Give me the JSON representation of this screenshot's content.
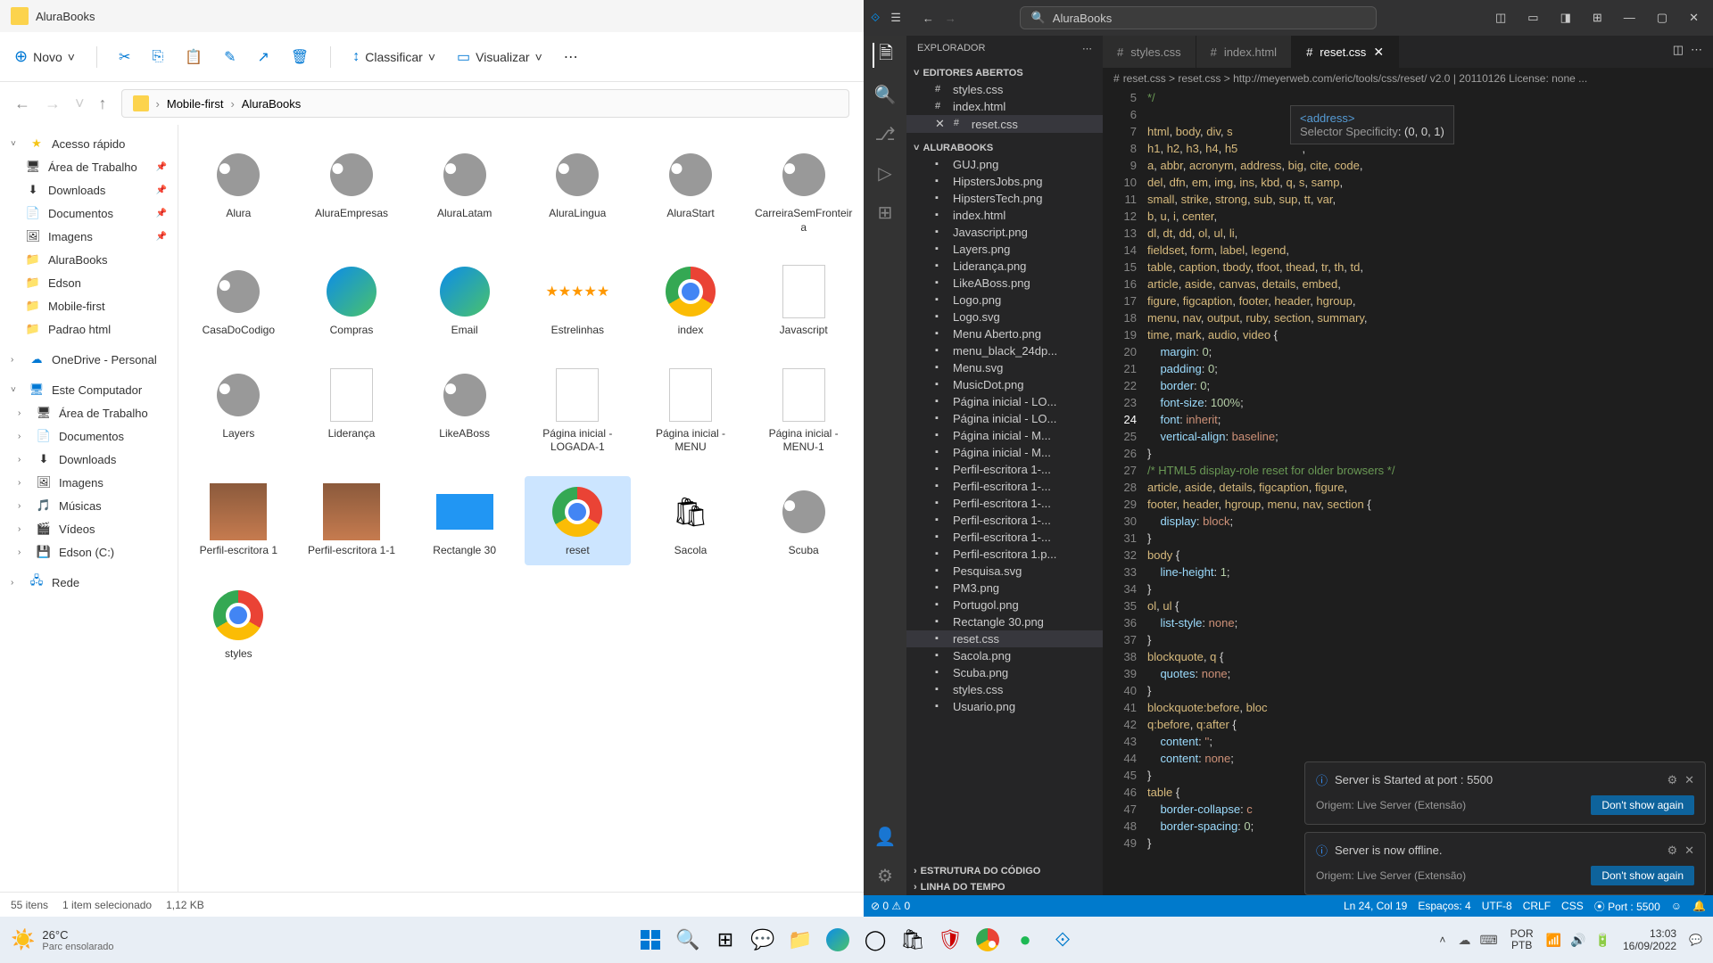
{
  "explorer": {
    "title": "AluraBooks",
    "toolbar": {
      "novo": "Novo",
      "classificar": "Classificar",
      "visualizar": "Visualizar"
    },
    "breadcrumb": [
      "Mobile-first",
      "AluraBooks"
    ],
    "sidebar": {
      "quick_access": "Acesso rápido",
      "items_pinned": [
        "Área de Trabalho",
        "Downloads",
        "Documentos",
        "Imagens",
        "AluraBooks",
        "Edson",
        "Mobile-first",
        "Padrao html"
      ],
      "onedrive": "OneDrive - Personal",
      "this_pc": "Este Computador",
      "pc_items": [
        "Área de Trabalho",
        "Documentos",
        "Downloads",
        "Imagens",
        "Músicas",
        "Vídeos",
        "Edson  (C:)"
      ],
      "network": "Rede"
    },
    "files": [
      "Alura",
      "AluraEmpresas",
      "AluraLatam",
      "AluraLingua",
      "AluraStart",
      "CarreiraSemFronteira",
      "CasaDoCodigo",
      "Compras",
      "Email",
      "Estrelinhas",
      "index",
      "Javascript",
      "Layers",
      "Liderança",
      "LikeABoss",
      "Página inicial - LOGADA-1",
      "Página inicial - MENU",
      "Página inicial - MENU-1",
      "Perfil-escritora 1",
      "Perfil-escritora 1-1",
      "Rectangle 30",
      "reset",
      "Sacola",
      "Scuba",
      "styles"
    ],
    "status": {
      "count": "55 itens",
      "selected": "1 item selecionado",
      "size": "1,12 KB"
    }
  },
  "vscode": {
    "search_title": "AluraBooks",
    "sidebar": {
      "title": "EXPLORADOR",
      "open_editors": "EDITORES ABERTOS",
      "open_files": [
        "styles.css",
        "index.html",
        "reset.css"
      ],
      "project": "ALURABOOKS",
      "files": [
        "GUJ.png",
        "HipstersJobs.png",
        "HipstersTech.png",
        "index.html",
        "Javascript.png",
        "Layers.png",
        "Liderança.png",
        "LikeABoss.png",
        "Logo.png",
        "Logo.svg",
        "Menu Aberto.png",
        "menu_black_24dp...",
        "Menu.svg",
        "MusicDot.png",
        "Página inicial - LO...",
        "Página inicial - LO...",
        "Página inicial - M...",
        "Página inicial - M...",
        "Perfil-escritora 1-...",
        "Perfil-escritora 1-...",
        "Perfil-escritora 1-...",
        "Perfil-escritora 1-...",
        "Perfil-escritora 1-...",
        "Perfil-escritora 1.p...",
        "Pesquisa.svg",
        "PM3.png",
        "Portugol.png",
        "Rectangle 30.png",
        "reset.css",
        "Sacola.png",
        "Scuba.png",
        "styles.css",
        "Usuario.png"
      ],
      "outline": "ESTRUTURA DO CÓDIGO",
      "timeline": "LINHA DO TEMPO"
    },
    "tabs": [
      "styles.css",
      "index.html",
      "reset.css"
    ],
    "active_tab": "reset.css",
    "breadcrumb": "reset.css > reset.css > http://meyerweb.com/eric/tools/css/reset/   v2.0 | 20110126   License: none ...",
    "tooltip": {
      "tag": "<address>",
      "spec_label": "Selector Specificity",
      "spec_value": ": (0, 0, 1)"
    },
    "notifications": [
      {
        "msg": "Server is Started at port : 5500",
        "origin": "Origem: Live Server (Extensão)",
        "btn": "Don't show again"
      },
      {
        "msg": "Server is now offline.",
        "origin": "Origem: Live Server (Extensão)",
        "btn": "Don't show again"
      }
    ],
    "status": {
      "errors": "⊘ 0 ⚠ 0",
      "line": "Ln 24, Col 19",
      "spaces": "Espaços: 4",
      "encoding": "UTF-8",
      "eol": "CRLF",
      "lang": "CSS",
      "port": "⦿ Port : 5500",
      "feedback": "☺"
    },
    "gutter_start": 5,
    "gutter_end": 49
  },
  "taskbar": {
    "weather_temp": "26°C",
    "weather_desc": "Parc ensolarado",
    "lang1": "POR",
    "lang2": "PTB",
    "time": "13:03",
    "date": "16/09/2022"
  }
}
